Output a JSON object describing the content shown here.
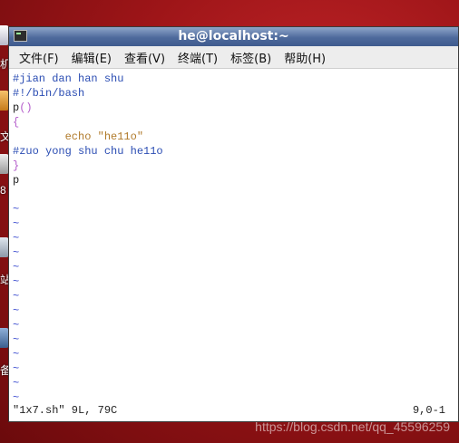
{
  "window": {
    "title": "he@localhost:~"
  },
  "menubar": {
    "items": [
      "文件(F)",
      "编辑(E)",
      "查看(V)",
      "终端(T)",
      "标签(B)",
      "帮助(H)"
    ]
  },
  "editor": {
    "lines": [
      {
        "text": "#jian dan han shu",
        "kind": "comment"
      },
      {
        "text": "#!/bin/bash",
        "kind": "comment"
      },
      {
        "text": "p()",
        "kind": "func"
      },
      {
        "text": "{",
        "kind": "paren"
      },
      {
        "text": "        echo \"he11o\"",
        "kind": "echo"
      },
      {
        "text": "#zuo yong shu chu he11o",
        "kind": "comment"
      },
      {
        "text": "}",
        "kind": "paren"
      },
      {
        "text": "p",
        "kind": "plain"
      },
      {
        "text": "",
        "kind": "plain"
      }
    ],
    "tilde_count": 15,
    "tilde_char": "~"
  },
  "status": {
    "file_info": "\"1x7.sh\" 9L, 79C",
    "position": "9,0-1"
  },
  "desktop": {
    "glyphs": [
      "机",
      "文",
      "8",
      "站",
      "备"
    ]
  },
  "watermark": "https://blog.csdn.net/qq_45596259",
  "colors": {
    "titlebar": "#4e6a9c",
    "comment": "#2b4db3",
    "paren": "#b45ccb",
    "string": "#b07a2a",
    "tilde": "#3f4fd0",
    "desktop_bg": "#9e1518"
  }
}
